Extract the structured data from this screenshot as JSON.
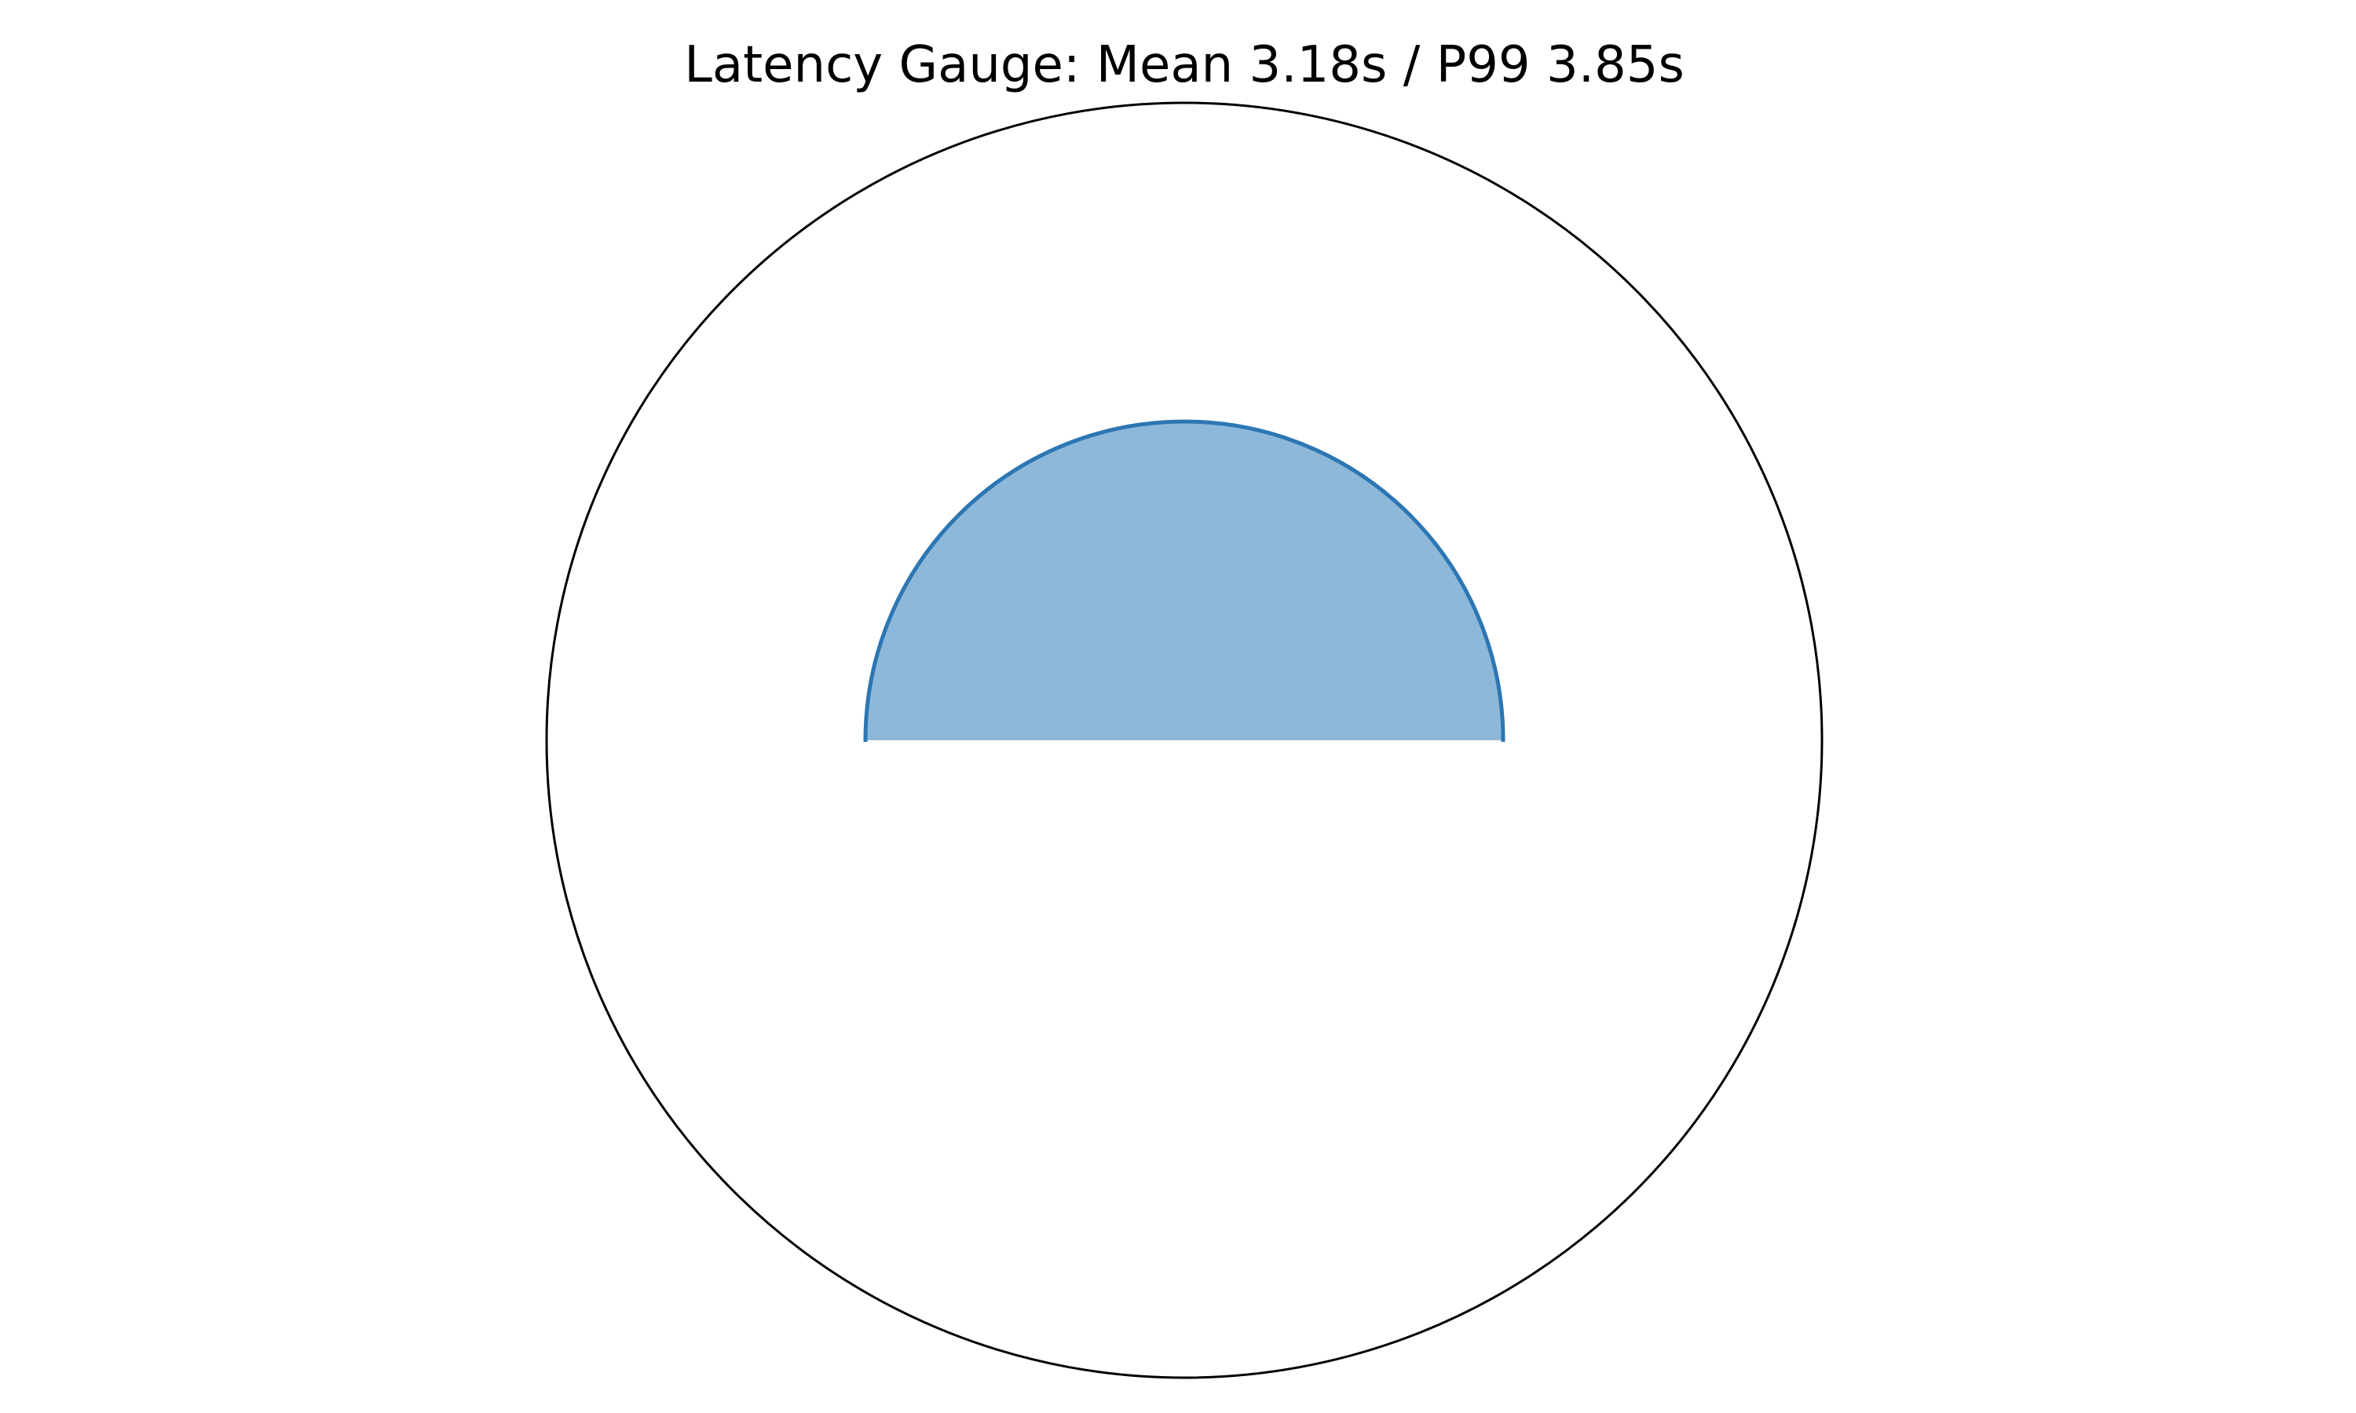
{
  "chart_data": {
    "type": "pie",
    "title": "Latency Gauge: Mean 3.18s / P99 3.85s",
    "gauge": {
      "outer_ring": true,
      "fill_shape": "semicircle",
      "fill_fraction": 0.5,
      "fill_radius_fraction": 0.5
    },
    "grid": false,
    "legend": false,
    "colors": {
      "ring": "#000000",
      "fill": "#8db8d9",
      "fill_edge": "#2c76b3"
    }
  }
}
